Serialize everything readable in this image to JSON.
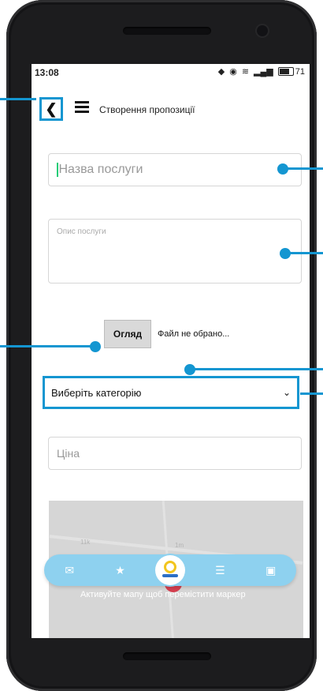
{
  "status_bar": {
    "time": "13:08",
    "battery": "71"
  },
  "header": {
    "title": "Створення пропозиції"
  },
  "form": {
    "service_name_placeholder": "Назва послуги",
    "description_placeholder": "Опис послуги",
    "file_button": "Огляд",
    "file_status": "Файл не обрано...",
    "category_select": "Виберіть категорію",
    "price_placeholder": "Ціна",
    "map_hint": "Активуйте мапу щоб перемістити маркер"
  },
  "map_labels": [
    "11k",
    "1m"
  ],
  "colors": {
    "accent": "#1496d1",
    "nav": "#8ed1ef",
    "marker": "#d43f4f"
  },
  "bottom_nav": {
    "items": [
      "mail-icon",
      "star-icon",
      "logo-icon",
      "list-icon",
      "clipboard-icon"
    ]
  }
}
